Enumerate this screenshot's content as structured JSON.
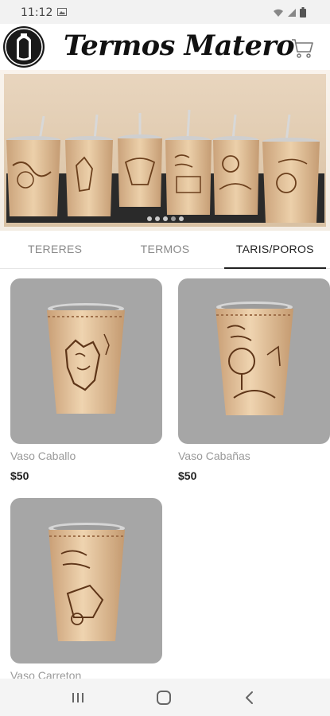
{
  "status_bar": {
    "time": "11:12",
    "icons": [
      "image-icon",
      "wifi-icon",
      "signal-icon",
      "battery-icon"
    ]
  },
  "header": {
    "title": "Termos Matero",
    "logo": "thermos-logo",
    "cart_icon": "cart-icon"
  },
  "banner": {
    "slides": 5,
    "active_slide": 4
  },
  "tabs": [
    {
      "label": "TERERES",
      "active": false
    },
    {
      "label": "TERMOS",
      "active": false
    },
    {
      "label": "TARIS/POROS",
      "active": true
    }
  ],
  "products": [
    {
      "name": "Vaso Caballo",
      "price": "$50"
    },
    {
      "name": "Vaso Cabañas",
      "price": "$50"
    },
    {
      "name": "Vaso Carreton",
      "price": ""
    }
  ],
  "colors": {
    "card_background": "#a6a6a6",
    "leather": "#e3c39c",
    "active_tab": "#222222",
    "inactive_tab": "#8a8a8a"
  },
  "nav_bar": {
    "icons": [
      "recents-icon",
      "home-icon",
      "back-icon"
    ]
  }
}
